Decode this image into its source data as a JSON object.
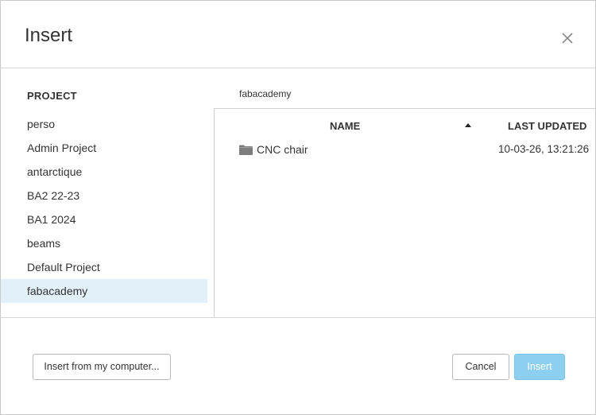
{
  "dialog": {
    "title": "Insert"
  },
  "projects": {
    "heading": "PROJECT",
    "items": [
      {
        "label": "perso"
      },
      {
        "label": "Admin Project"
      },
      {
        "label": "antarctique"
      },
      {
        "label": "BA2 22-23"
      },
      {
        "label": "BA1 2024"
      },
      {
        "label": "beams"
      },
      {
        "label": "Default Project"
      },
      {
        "label": "fabacademy",
        "selected": true
      }
    ]
  },
  "browser": {
    "breadcrumb": "fabacademy",
    "columns": {
      "name": "NAME",
      "last_updated": "LAST UPDATED"
    },
    "sort": {
      "column": "name",
      "direction": "ascending"
    },
    "rows": [
      {
        "icon": "folder-icon",
        "name": "CNC chair",
        "updated": "10-03-26, 13:21:26"
      }
    ]
  },
  "footer": {
    "upload_label": "Insert from my computer...",
    "cancel_label": "Cancel",
    "insert_label": "Insert",
    "insert_enabled": false
  },
  "colors": {
    "selected_row_bg": "#e1f0f9",
    "insert_button_bg": "#8ccfee"
  }
}
